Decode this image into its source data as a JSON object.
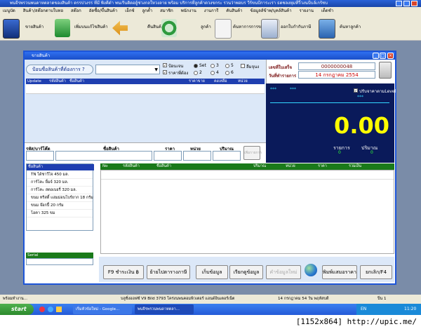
{
  "app_title": "พนจีรพรวนพนดาหตลาดของสินค้า ดรรปวงรร ที่มี พิงคีด๋า พนเริ่นดิดอยู้ช่วงกลใหวงลาย พร้อม บริการที่ลูกค้าดวงขกระ รวนว่าพอบร วีร์ขนบีการะเรา ธตชลงหุมที่วิ้วงนบีบล์เกร้ชบ",
  "menu": [
    "เมนูบัด",
    "สินค้า/สต๊อกตาบใบทอ",
    "สต๊อก",
    "อัดซื้อ/ขึ้นสินค้า",
    "เอ็กซ์",
    "ลูกค้ำ",
    "สมาชิก",
    "พนักงาน",
    "งานการี",
    "คันสินค้า",
    "ข้อมูลส์ข้าพ/บุคล์สินค้า",
    "รายงาน",
    "เด็ดชำ"
  ],
  "toolbar": [
    {
      "label": "ขายสินค้า",
      "icon": "monitor-icon"
    },
    {
      "label": "เพิ่มบนแก้ไขสินค้า",
      "icon": "add-product-icon"
    },
    {
      "label": "คืนสินค้า",
      "icon": "return-icon"
    },
    {
      "label": "ลูกค้า",
      "icon": "customer-icon"
    },
    {
      "label": "ค้นหาการการขาย",
      "icon": "sales-search-icon"
    },
    {
      "label": "ออกใบกำกับภาษี",
      "icon": "invoice-icon"
    },
    {
      "label": "ค้นหาลูกค้า",
      "icon": "search-customer-icon"
    }
  ],
  "sale_window": {
    "title": "ขายสินค้า",
    "search_placeholder": "ป้อนชื่อสินค้าที่ต้องการ ?",
    "chk_discount": "ป้อนเจน",
    "chk_price": "ราคาพี่ต้อง",
    "radio_set": [
      "Set",
      "2",
      "3",
      "4",
      "5",
      "6"
    ],
    "chk_member": "ลืมจุนง",
    "grid1_headers": [
      "Update",
      "รหัสสินค้า",
      "ชื่อสินค้า",
      "ราคาขาย",
      "คงเหลือ",
      "หน่วย"
    ],
    "receipt_label": "เลขที่ใบเสร็จ",
    "receipt_value": "0000000048",
    "date_label": "วันที่ทำรายการ",
    "date_value": "14 กรกฎาคม 2554",
    "display_small_left": "***",
    "display_small_right": "***",
    "display_checkbox_label": "ปรับจาคาตามLevel",
    "display_mid": "***",
    "total": "0.00",
    "items_label": "รายการ",
    "items_value": "0",
    "qty_label": "ปริมาณ",
    "qty_value": "0",
    "entry_headers": [
      "รหัส/บาร์โค๊ต",
      "ชื่อสินค้า",
      "ราคา",
      "หน่วย",
      "ปริมาณ"
    ],
    "add_btn": "เพิ่มรายการ",
    "list_header": "ชื่อสินค้า",
    "list_items": [
      "TN ได้ชาวีไจ 450 มล.",
      "การ์โคะ ยิ้มจ์ 320 มล.",
      "การ์โคะ สตอเบอรี่ 320 มล.",
      "ขนม ทริสดี้ แฮมม่อนโบร์ยาก 18 กรัม",
      "ขนม จ๊อกปี้ 20 กรัม",
      "โอคา 325 ขม"
    ],
    "grid2_headers": [
      "No",
      "รหัสสินค้า",
      "ชื่อสินค้า",
      "ปริมาณ",
      "หน่วย",
      "ราคา",
      "รวมเงิน"
    ],
    "serial_label": "Serial",
    "buttons": [
      "F9 ชำระเงิน ฿",
      "ย้ายไปตารางภาษี",
      "เก็บข้อมูล",
      "เรียกดูข้อมูล",
      "คำข้อมูลใหม่",
      "พิมพ์แสมอราคา",
      "ยกเลิก/F4"
    ]
  },
  "status": {
    "left": "พร้อมทำงาน...",
    "mid": "บลูชิ่งออฟซ์ V9 Bild 3793 โคร่งนพนคอมพิวเตอร์ แอนด์อินเตอร์เน็ต",
    "date": "14 กรกฎาคม 54  วัน พฤหัสบดี",
    "version": "ป็น  1"
  },
  "taskbar": {
    "start": "start",
    "tasks": [
      "เริ่มหัวข้อใหม่ - Google...",
      "พนจีรพรวนพนดาหตลา..."
    ],
    "lang": "EN",
    "time": "11:20"
  },
  "watermark": "[1152x864] http://upic.me/",
  "colors": {
    "accent": "#1d55d8",
    "display_bg": "#0a1a5a",
    "total": "#ffff00",
    "grid_head": "#1f3fb0",
    "green_head": "#1a7a1a"
  }
}
